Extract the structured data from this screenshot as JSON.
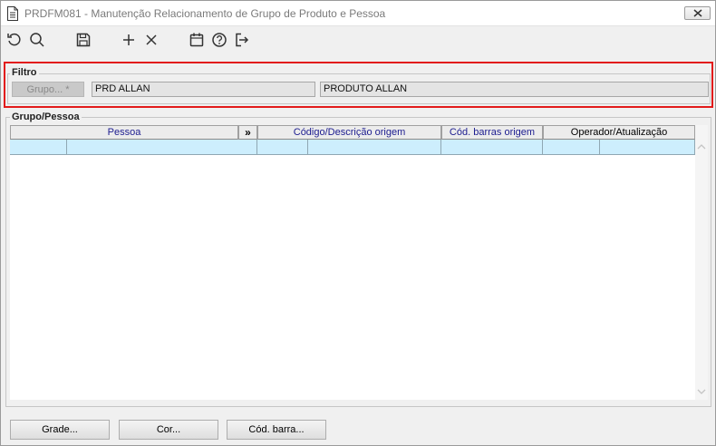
{
  "window": {
    "title": "PRDFM081 - Manutenção Relacionamento de Grupo de Produto e Pessoa"
  },
  "toolbar": {
    "icons": [
      "undo-icon",
      "search-icon",
      "save-icon",
      "add-icon",
      "delete-icon",
      "calendar-icon",
      "help-icon",
      "exit-icon"
    ]
  },
  "filtro": {
    "legend": "Filtro",
    "grupo_button": "Grupo... *",
    "grupo_code": "PRD ALLAN",
    "grupo_description": "PRODUTO ALLAN"
  },
  "grupo_pessoa": {
    "legend": "Grupo/Pessoa",
    "columns": {
      "pessoa": "Pessoa",
      "expand": "»",
      "codigo_descricao_origem": "Código/Descrição origem",
      "cod_barras_origem": "Cód. barras origem",
      "operador_atualizacao": "Operador/Atualização"
    }
  },
  "buttons": {
    "grade": "Grade...",
    "cor": "Cor...",
    "cod_barra": "Cód. barra..."
  },
  "colors": {
    "highlight": "#e21b1b",
    "selected_row": "#cdeefd",
    "header_text_blue": "#1b1b8f"
  }
}
